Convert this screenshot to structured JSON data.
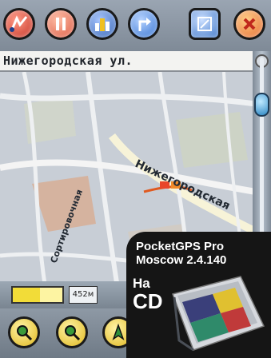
{
  "toolbar_top": {
    "buttons": [
      {
        "name": "route-button",
        "icon": "route-icon",
        "color": "#d83a2a"
      },
      {
        "name": "pause-button",
        "icon": "pause-icon",
        "color": "#e0523a"
      },
      {
        "name": "city-button",
        "icon": "city-icon",
        "color": "#2f5fb0"
      },
      {
        "name": "turn-button",
        "icon": "turn-arrow-icon",
        "color": "#2f6fd0"
      },
      {
        "name": "fullscreen-button",
        "icon": "fullscreen-icon",
        "color": "#3f78c9"
      },
      {
        "name": "close-button",
        "icon": "close-icon",
        "color": "#e46a2a"
      }
    ]
  },
  "address_bar": {
    "street": "Нижегородская ул."
  },
  "map": {
    "street_labels": [
      "Нижегородская",
      "Сортировочная"
    ]
  },
  "status": {
    "scale": "452м",
    "gps_signal_fraction": 0.55
  },
  "toolbar_bottom": {
    "buttons": [
      {
        "name": "zoom-in-button",
        "icon": "magnifier-plus-icon"
      },
      {
        "name": "zoom-out-button",
        "icon": "magnifier-minus-icon"
      },
      {
        "name": "gps-button",
        "icon": "gps-icon"
      }
    ]
  },
  "cd_overlay": {
    "title_line1": "PocketGPS Pro",
    "title_line2": "Moscow 2.4.140",
    "na": "На",
    "cd": "CD"
  }
}
